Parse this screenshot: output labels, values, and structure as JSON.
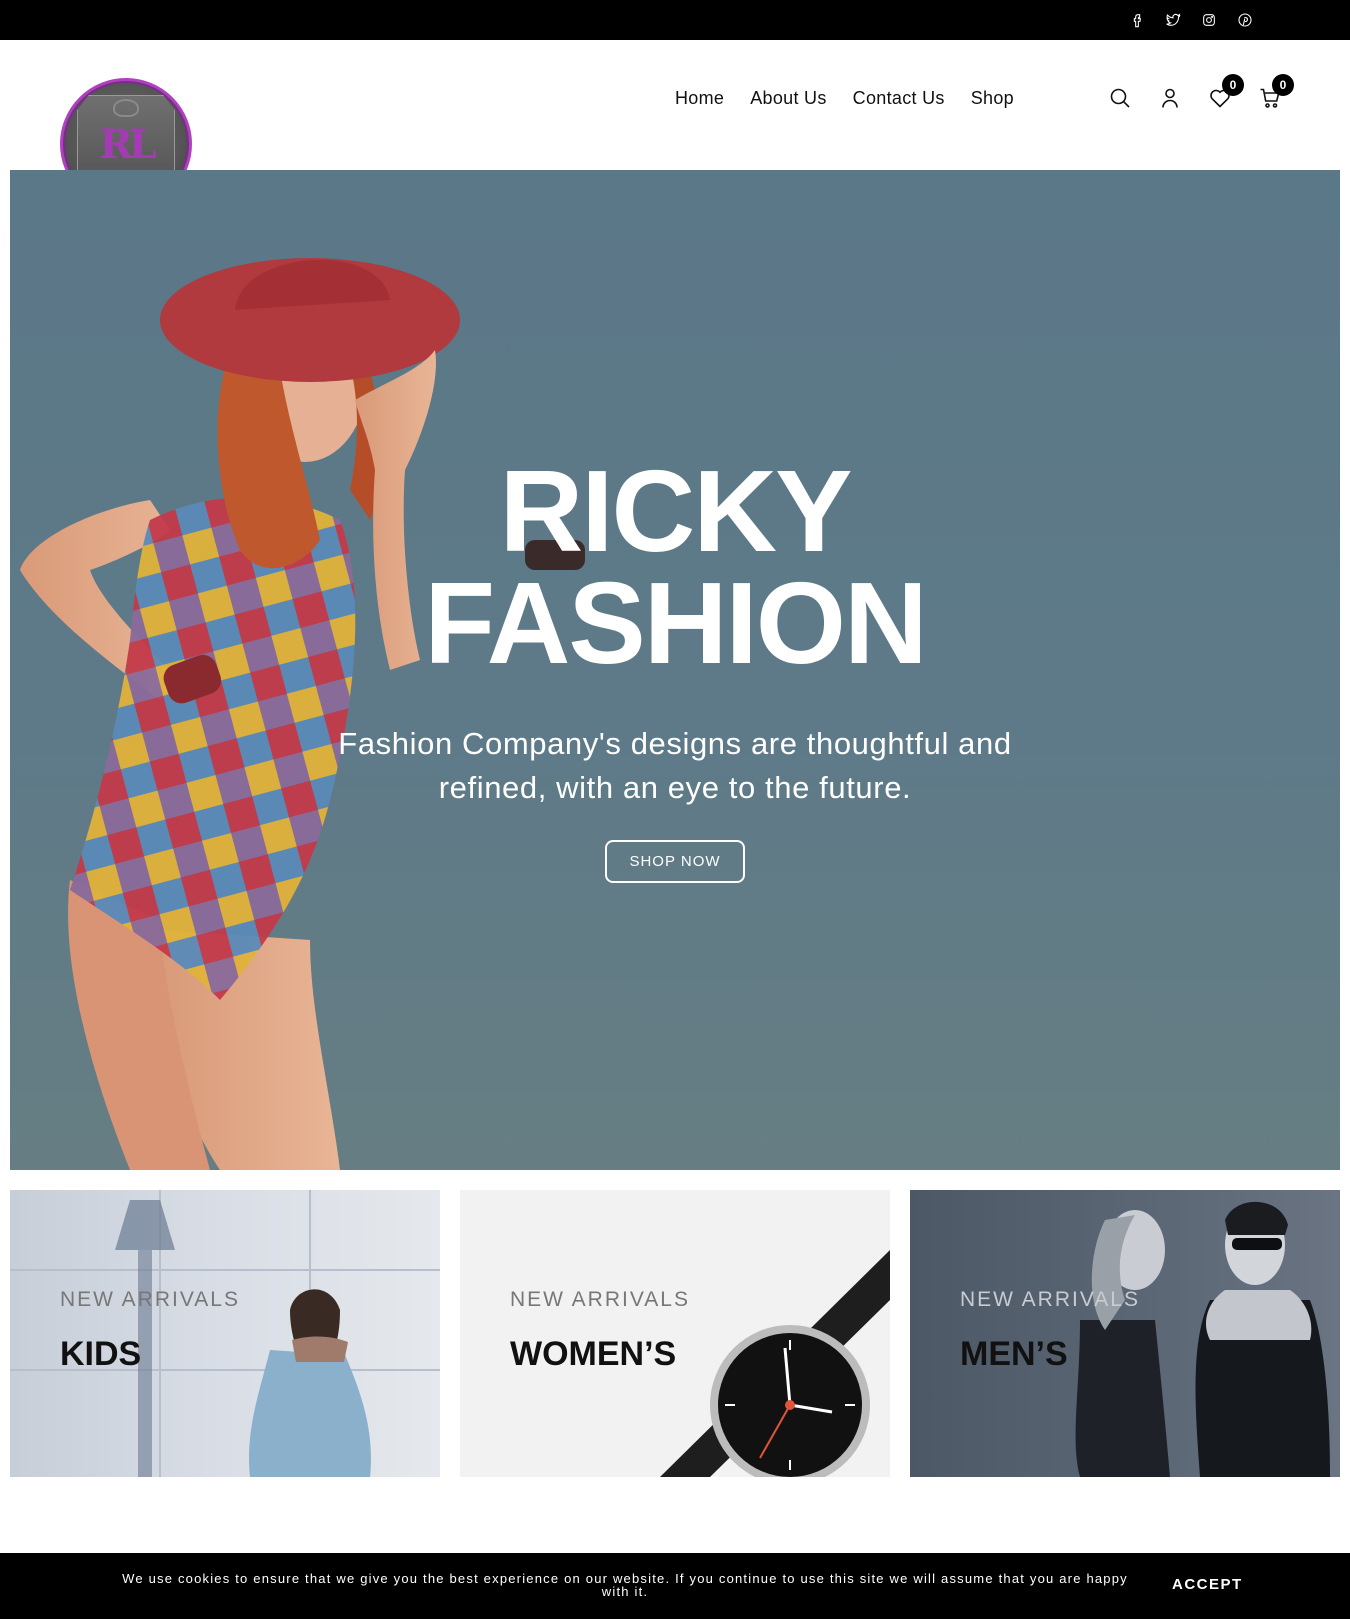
{
  "topbar": {
    "social": [
      "facebook-icon",
      "twitter-icon",
      "instagram-icon",
      "pinterest-icon"
    ]
  },
  "brand": {
    "logo_monogram": "RL",
    "accent": "#a43bb5"
  },
  "nav": {
    "items": [
      "Home",
      "About Us",
      "Contact Us",
      "Shop"
    ]
  },
  "header_icons": {
    "search": "search-icon",
    "account": "user-icon",
    "wishlist": "heart-icon",
    "wishlist_count": "0",
    "cart": "cart-icon",
    "cart_count": "0"
  },
  "hero": {
    "title_line1": "RICKY",
    "title_line2": "FASHION",
    "subtitle_line1": "Fashion Company's designs are thoughtful and",
    "subtitle_line2": "refined, with an eye to the future.",
    "button": "SHOP NOW",
    "background": "#5e7a88"
  },
  "categories": [
    {
      "kicker": "NEW ARRIVALS",
      "name": "KIDS"
    },
    {
      "kicker": "NEW ARRIVALS",
      "name": "WOMEN’S"
    },
    {
      "kicker": "NEW ARRIVALS",
      "name": "MEN’S"
    }
  ],
  "cookie": {
    "text": "We use cookies to ensure that we give you the best experience on our website. If you continue to use this site we will assume that you are happy with it.",
    "accept": "ACCEPT"
  }
}
